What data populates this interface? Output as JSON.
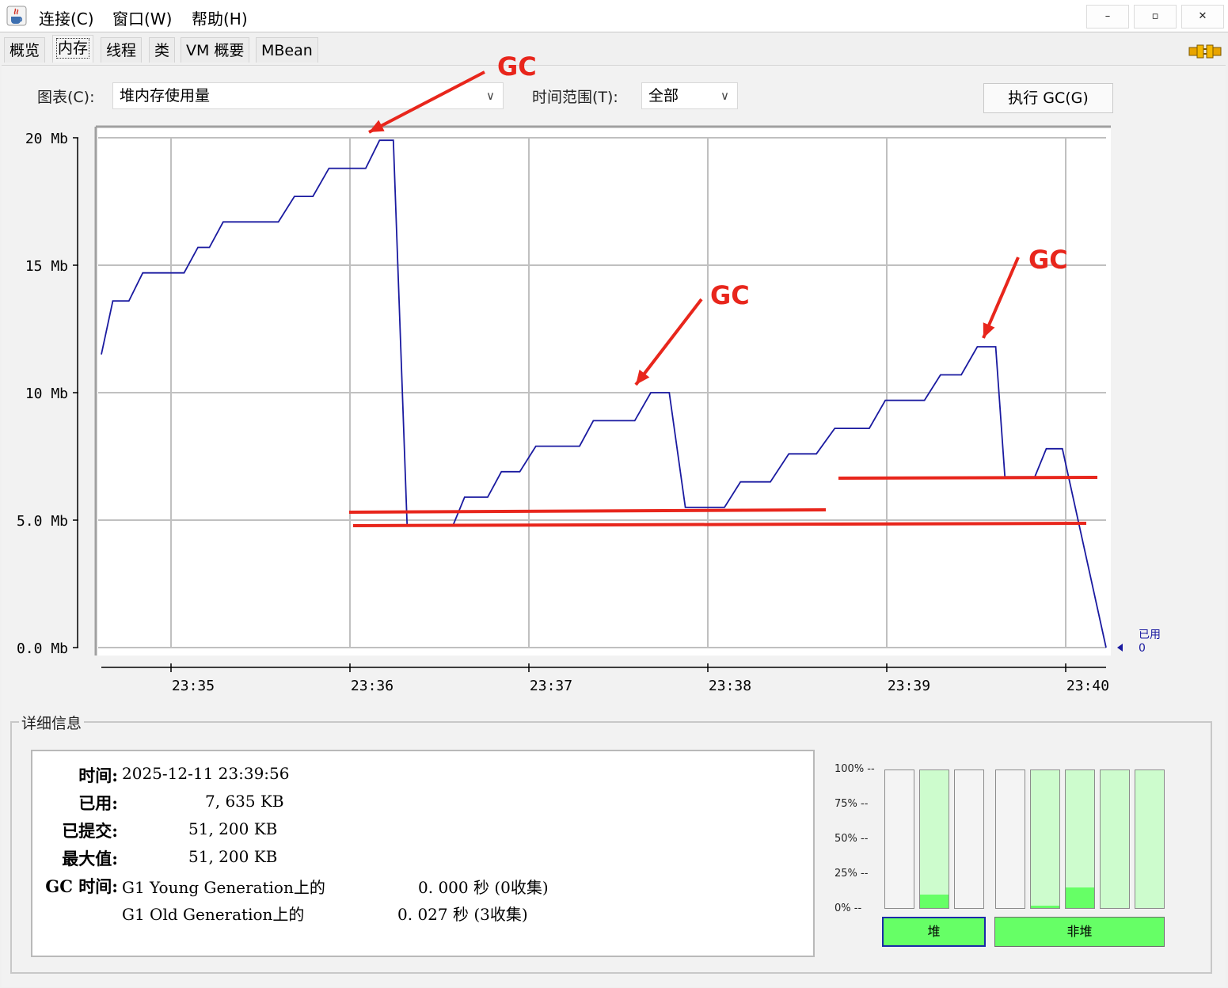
{
  "menu": {
    "connect": "连接(C)",
    "window": "窗口(W)",
    "help": "帮助(H)"
  },
  "window_controls": {
    "minimize": "–",
    "restore": "▫",
    "close": "✕"
  },
  "tabs": [
    {
      "label": "概览",
      "active": false
    },
    {
      "label": "内存",
      "active": true
    },
    {
      "label": "线程",
      "active": false
    },
    {
      "label": "类",
      "active": false
    },
    {
      "label": "VM 概要",
      "active": false
    },
    {
      "label": "MBean",
      "active": false
    }
  ],
  "toolbar": {
    "chart_label": "图表(C):",
    "chart_value": "堆内存使用量",
    "range_label": "时间范围(T):",
    "range_value": "全部",
    "gc_button": "执行 GC(G)"
  },
  "chart_data": {
    "type": "line",
    "y_ticks": [
      "20 Mb",
      "15 Mb",
      "10 Mb",
      "5.0 Mb",
      "0.0 Mb"
    ],
    "x_ticks": [
      "23:35",
      "23:36",
      "23:37",
      "23:38",
      "23:39",
      "23:40"
    ],
    "ylim": [
      0,
      20
    ],
    "xlim": [
      "23:34:35",
      "23:40:08"
    ],
    "grid": true,
    "legend": {
      "label": "已用",
      "value": "0",
      "placement": "right-bottom"
    },
    "series": [
      {
        "name": "已用",
        "color": "#1a1aa0",
        "points": [
          [
            "23:34:35",
            11.6
          ],
          [
            "23:34:41",
            13.6
          ],
          [
            "23:34:48",
            13.6
          ],
          [
            "23:34:54",
            14.7
          ],
          [
            "23:35:15",
            14.7
          ],
          [
            "23:35:22",
            15.7
          ],
          [
            "23:35:29",
            15.7
          ],
          [
            "23:35:36",
            16.7
          ],
          [
            "23:36:04",
            16.7
          ],
          [
            "23:36:11",
            17.7
          ],
          [
            "23:36:19",
            17.7
          ],
          [
            "23:36:27",
            18.8
          ],
          [
            "23:36:34",
            18.8
          ],
          [
            "23:36:42",
            19.9
          ],
          [
            "23:36:47",
            19.9
          ],
          [
            "23:36:02",
            19.9
          ]
        ]
      }
    ],
    "line_points": [
      [
        0,
        11.5
      ],
      [
        5,
        13.6
      ],
      [
        12,
        13.6
      ],
      [
        18,
        14.7
      ],
      [
        36,
        14.7
      ],
      [
        42,
        15.7
      ],
      [
        47,
        15.7
      ],
      [
        53,
        16.7
      ],
      [
        77,
        16.7
      ],
      [
        84,
        17.7
      ],
      [
        92,
        17.7
      ],
      [
        99,
        18.8
      ],
      [
        115,
        18.8
      ],
      [
        121,
        19.9
      ],
      [
        127,
        19.9
      ],
      [
        133,
        4.8
      ],
      [
        153,
        4.8
      ],
      [
        158,
        5.9
      ],
      [
        168,
        5.9
      ],
      [
        174,
        6.9
      ],
      [
        182,
        6.9
      ],
      [
        189,
        7.9
      ],
      [
        208,
        7.9
      ],
      [
        214,
        8.9
      ],
      [
        232,
        8.9
      ],
      [
        239,
        10.0
      ],
      [
        247,
        10.0
      ],
      [
        254,
        5.5
      ],
      [
        271,
        5.5
      ],
      [
        278,
        6.5
      ],
      [
        291,
        6.5
      ],
      [
        299,
        7.6
      ],
      [
        311,
        7.6
      ],
      [
        319,
        8.6
      ],
      [
        334,
        8.6
      ],
      [
        341,
        9.7
      ],
      [
        358,
        9.7
      ],
      [
        365,
        10.7
      ],
      [
        374,
        10.7
      ],
      [
        381,
        11.8
      ],
      [
        389,
        11.8
      ],
      [
        393,
        6.7
      ],
      [
        406,
        6.7
      ],
      [
        411,
        7.8
      ],
      [
        418,
        7.8
      ],
      [
        437,
        0.0
      ]
    ],
    "x_per_minute": 60
  },
  "annotations": {
    "gc1": "GC",
    "gc2": "GC",
    "gc3": "GC"
  },
  "details": {
    "title": "详细信息",
    "time_label": "时间:",
    "time_value": "2025-12-11 23:39:56",
    "used_label": "已用:",
    "used_value": "7, 635 KB",
    "committed_label": "已提交:",
    "committed_value": "51, 200 KB",
    "max_label": "最大值:",
    "max_value": "51, 200 KB",
    "gc_label": "GC 时间:",
    "gc_young_name": "G1 Young Generation上的",
    "gc_young_value": "0. 000  秒 (0收集)",
    "gc_old_name": "G1 Old Generation上的",
    "gc_old_value": "0. 027  秒 (3收集)"
  },
  "pools": {
    "percent_labels": [
      "100%",
      "75%",
      "50%",
      "25%",
      "0%"
    ],
    "heap_bars": [
      {
        "max": 0.0,
        "used": 0.0
      },
      {
        "max": 1.0,
        "used": 0.1
      },
      {
        "max": 0.0,
        "used": 0.0
      }
    ],
    "nonheap_bars": [
      {
        "max": 0.0,
        "used": 0.0
      },
      {
        "max": 1.0,
        "used": 0.02
      },
      {
        "max": 1.0,
        "used": 0.15
      },
      {
        "max": 1.0,
        "used": 0.0
      },
      {
        "max": 1.0,
        "used": 0.0
      }
    ],
    "heap_button": "堆",
    "nonheap_button": "非堆"
  }
}
